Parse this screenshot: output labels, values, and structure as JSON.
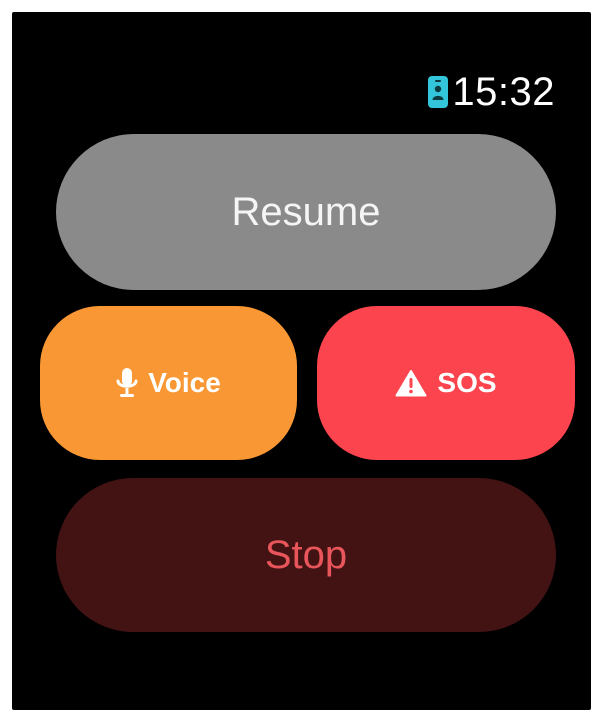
{
  "status_bar": {
    "time": "15:32",
    "badge_icon": "person-badge-icon",
    "badge_color": "#33c6da"
  },
  "controls": {
    "resume": {
      "label": "Resume",
      "color": "#8a8a8a"
    },
    "voice": {
      "label": "Voice",
      "icon": "microphone-icon",
      "color": "#f89733"
    },
    "sos": {
      "label": "SOS",
      "icon": "warning-triangle-icon",
      "color": "#fc444e"
    },
    "stop": {
      "label": "Stop",
      "color": "#431314",
      "text_color": "#e8555b"
    }
  }
}
